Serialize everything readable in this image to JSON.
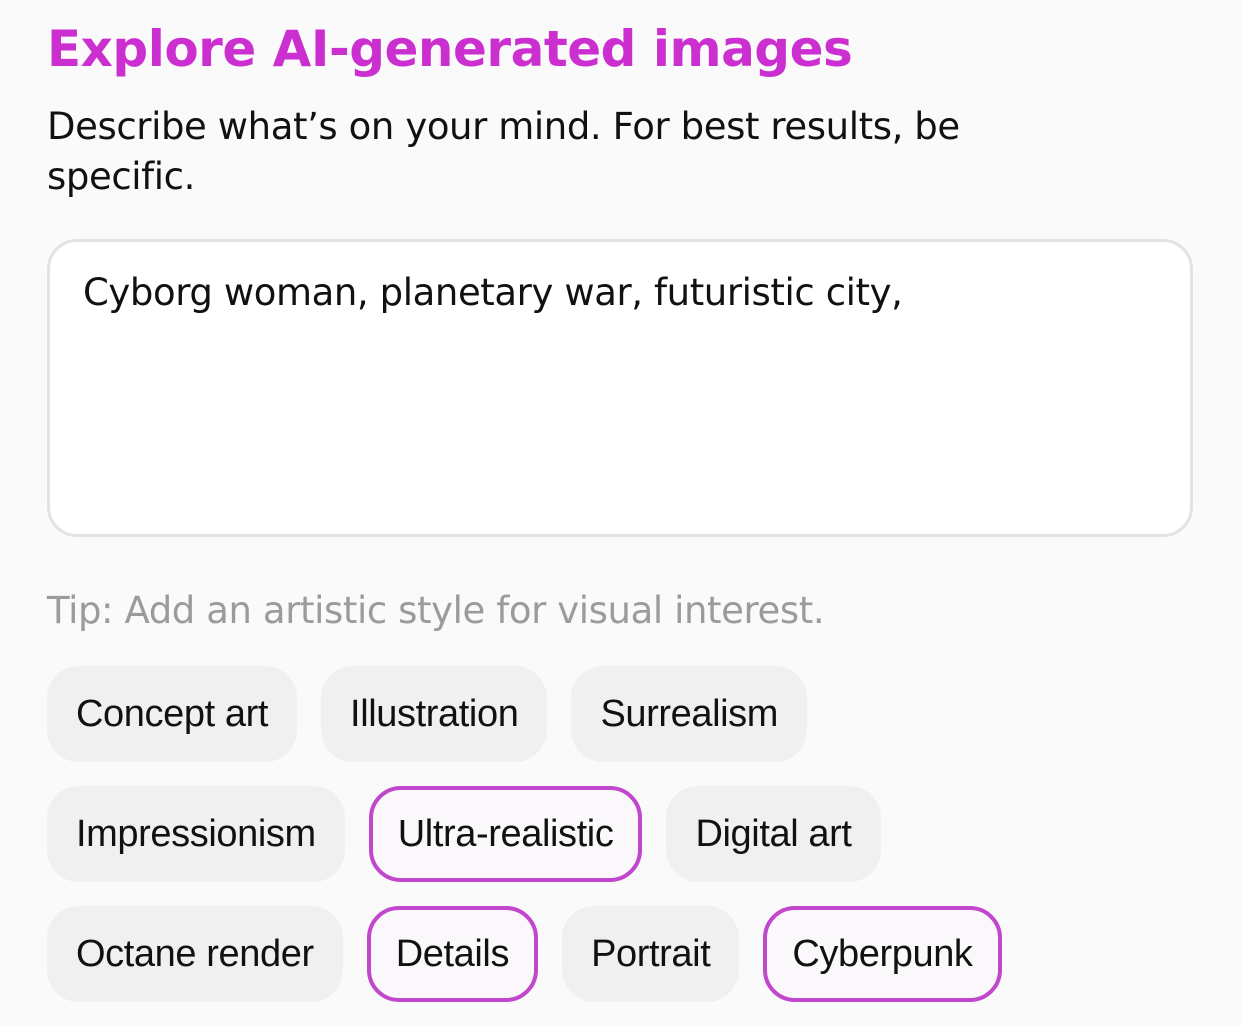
{
  "colors": {
    "accent": "#cc2fcf",
    "selected_border": "#c147cd",
    "chip_background": "#f0f0f0",
    "input_border": "#e2e2e2",
    "tip_text": "#9b9b9b"
  },
  "header": {
    "title": "Explore AI-generated images",
    "subtitle": "Describe what’s on your mind. For best results, be specific."
  },
  "prompt": {
    "value": "Cyborg woman, planetary war, futuristic city,"
  },
  "tip": {
    "text": "Tip: Add an artistic style for visual interest."
  },
  "styles": {
    "rows": [
      [
        {
          "label": "Concept art",
          "selected": false
        },
        {
          "label": "Illustration",
          "selected": false
        },
        {
          "label": "Surrealism",
          "selected": false
        }
      ],
      [
        {
          "label": "Impressionism",
          "selected": false
        },
        {
          "label": "Ultra-realistic",
          "selected": true
        },
        {
          "label": "Digital art",
          "selected": false
        }
      ],
      [
        {
          "label": "Octane render",
          "selected": false
        },
        {
          "label": "Details",
          "selected": true
        },
        {
          "label": "Portrait",
          "selected": false
        },
        {
          "label": "Cyberpunk",
          "selected": true
        }
      ]
    ]
  }
}
